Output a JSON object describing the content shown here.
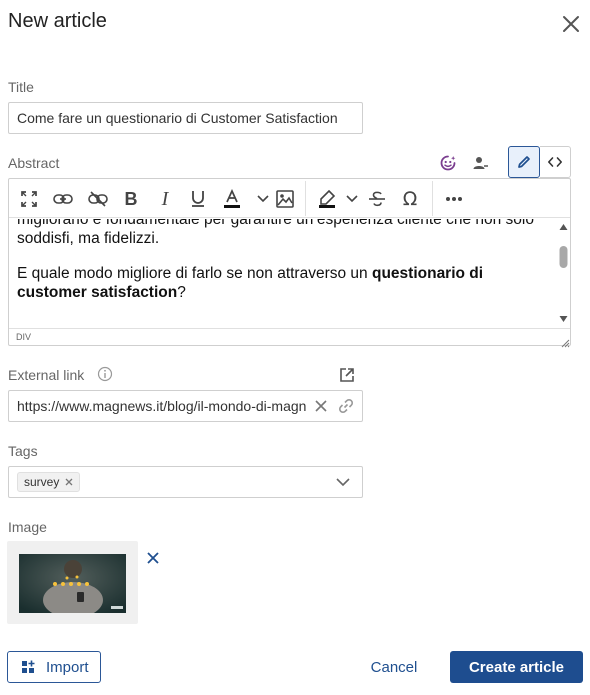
{
  "dialog": {
    "title": "New article"
  },
  "fields": {
    "title": {
      "label": "Title",
      "value": "Come fare un questionario di Customer Satisfaction"
    },
    "abstract": {
      "label": "Abstract",
      "paragraph1": "migliorarlo è fondamentale per garantire un’esperienza cliente che non solo soddisfi, ma fidelizzi.",
      "paragraph2_prefix": "E quale modo migliore di farlo se non attraverso un ",
      "paragraph2_bold": "questionario di customer satisfaction",
      "paragraph2_suffix": "?",
      "status_path": "DIV"
    },
    "external_link": {
      "label": "External link",
      "value": "https://www.magnews.it/blog/il-mondo-di-magnews"
    },
    "tags": {
      "label": "Tags",
      "items": [
        "survey"
      ]
    },
    "image": {
      "label": "Image"
    }
  },
  "footer": {
    "import_label": "Import",
    "cancel_label": "Cancel",
    "create_label": "Create article"
  },
  "colors": {
    "primary": "#1e4d8f",
    "accent_purple": "#7a3d8f",
    "border": "#cfcfcf"
  }
}
